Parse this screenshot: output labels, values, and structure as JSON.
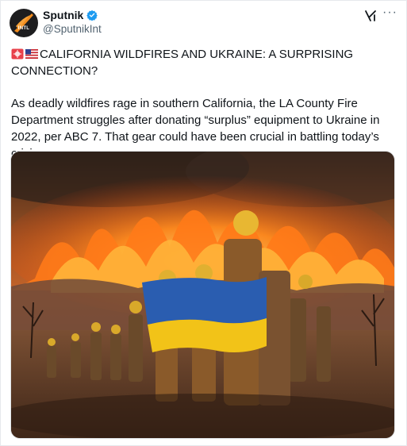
{
  "author": {
    "display_name": "Sputnik",
    "handle": "@SputnikInt",
    "avatar_label": "INTL",
    "verified": true
  },
  "actions": {
    "grok_icon": "grok-icon",
    "more_icon": "more-icon"
  },
  "post": {
    "headline": "CALIFORNIA WILDFIRES AND UKRAINE: A SURPRISING CONNECTION?",
    "headline_emojis": [
      "siren-emoji",
      "us-flag-emoji"
    ],
    "body": "As deadly wildfires rage in southern California, the LA County Fire Department struggles after donating “surplus” equipment to Ukraine in 2022, per ABC 7. That gear could have been crucial in battling today’s crisis"
  },
  "media": {
    "description_icon": "wildfire-firefighters-image"
  },
  "colors": {
    "verified": "#1d9bf0",
    "handle": "#536471",
    "text": "#0f1419",
    "flag_blue": "#2a5db0",
    "flag_yellow": "#f2c318"
  }
}
